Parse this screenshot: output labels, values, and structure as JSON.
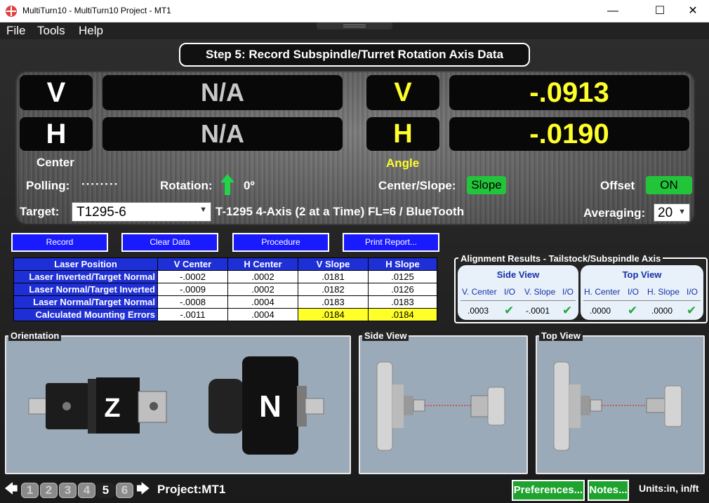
{
  "window": {
    "title": "MultiTurn10 - MultiTurn10 Project - MT1",
    "minimize": "—",
    "maximize": "☐",
    "close": "✕"
  },
  "menu": [
    "File",
    "Tools",
    "Help"
  ],
  "step_title": "Step 5: Record Subspindle/Turret Rotation Axis Data",
  "readouts": {
    "center_v_label": "V",
    "center_v_value": "N/A",
    "center_h_label": "H",
    "center_h_value": "N/A",
    "center_caption": "Center",
    "angle_v_label": "V",
    "angle_v_value": "-.0913",
    "angle_h_label": "H",
    "angle_h_value": "-.0190",
    "angle_caption": "Angle"
  },
  "status": {
    "polling_label": "Polling:",
    "polling_value": "········",
    "rotation_label": "Rotation:",
    "rotation_value": "0º",
    "center_slope_label": "Center/Slope:",
    "center_slope_value": "Slope",
    "offset_label": "Offset",
    "offset_value": "ON"
  },
  "target": {
    "label": "Target:",
    "value": "T1295-6",
    "description": "T-1295 4-Axis (2 at a Time) FL=6 / BlueTooth",
    "averaging_label": "Averaging:",
    "averaging_value": "20"
  },
  "buttons": {
    "record": "Record",
    "clear": "Clear Data",
    "procedure": "Procedure",
    "print": "Print Report..."
  },
  "table": {
    "headers": [
      "Laser Position",
      "V Center",
      "H Center",
      "V Slope",
      "H Slope"
    ],
    "rows": [
      {
        "label": "Laser Inverted/Target Normal",
        "values": [
          "-.0002",
          ".0002",
          ".0181",
          ".0125"
        ]
      },
      {
        "label": "Laser Normal/Target Inverted",
        "values": [
          "-.0009",
          ".0002",
          ".0182",
          ".0126"
        ]
      },
      {
        "label": "Laser Normal/Target Normal",
        "values": [
          "-.0008",
          ".0004",
          ".0183",
          ".0183"
        ]
      },
      {
        "label": "Calculated Mounting Errors",
        "values": [
          "-.0011",
          ".0004",
          ".0184",
          ".0184"
        ]
      }
    ]
  },
  "alignment": {
    "title": "Alignment Results - Tailstock/Subspindle Axis",
    "side": {
      "title": "Side View",
      "col1": "V. Center",
      "col2": "I/O",
      "col3": "V. Slope",
      "col4": "I/O",
      "val1": ".0003",
      "val2": "-.0001"
    },
    "top": {
      "title": "Top View",
      "col1": "H. Center",
      "col2": "I/O",
      "col3": "H. Slope",
      "col4": "I/O",
      "val1": ".0000",
      "val2": ".0000"
    },
    "check": "✔"
  },
  "panels": {
    "orientation": "Orientation",
    "side_view": "Side View",
    "top_view": "Top View",
    "mark_z": "Z",
    "mark_n": "N"
  },
  "footer": {
    "prev": "🡄",
    "next": "🡆",
    "steps": [
      "1",
      "2",
      "3",
      "4",
      "5",
      "6"
    ],
    "project": "Project:MT1",
    "preferences": "Preferences...",
    "notes": "Notes...",
    "units": "Units:in, in/ft"
  }
}
